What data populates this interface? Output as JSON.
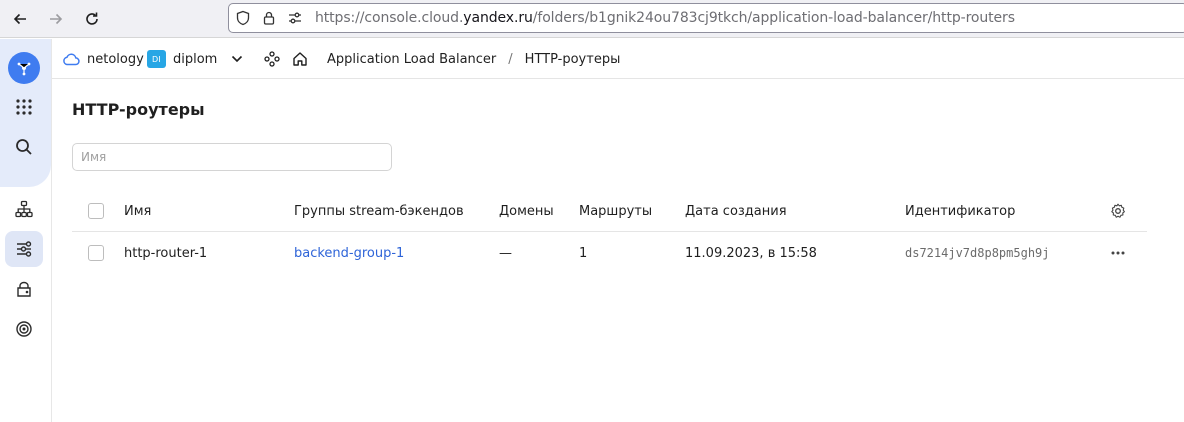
{
  "browser": {
    "url_prefix": "https://console.cloud.",
    "url_host": "yandex.ru",
    "url_path": "/folders/b1gnik24ou783cj9tkch/application-load-balancer/http-routers"
  },
  "header": {
    "cloud_name": "netology",
    "folder_badge": "DI",
    "folder_name": "diplom",
    "breadcrumb_service": "Application Load Balancer",
    "breadcrumb_separator": "/",
    "breadcrumb_current": "HTTP-роутеры"
  },
  "main": {
    "title": "HTTP-роутеры",
    "search_placeholder": "Имя"
  },
  "table": {
    "headers": {
      "name": "Имя",
      "backend_groups": "Группы stream-бэкендов",
      "domains": "Домены",
      "routes": "Маршруты",
      "created": "Дата создания",
      "id": "Идентификатор"
    },
    "rows": [
      {
        "name": "http-router-1",
        "backend_groups": "backend-group-1",
        "domains": "—",
        "routes": "1",
        "created": "11.09.2023, в 15:58",
        "id": "ds7214jv7d8p8pm5gh9j"
      }
    ]
  },
  "colors": {
    "accent": "#3f7cf0",
    "link": "#2e64d8",
    "folder_badge": "#27a6e5"
  },
  "icons": {
    "rail": [
      "cloud-logo-icon",
      "services-grid-icon",
      "search-icon",
      "network-icon",
      "load-balancer-icon",
      "storage-icon",
      "target-icon"
    ],
    "header": [
      "cloud-icon",
      "chevron-down-icon",
      "service-graph-icon",
      "home-icon"
    ]
  }
}
